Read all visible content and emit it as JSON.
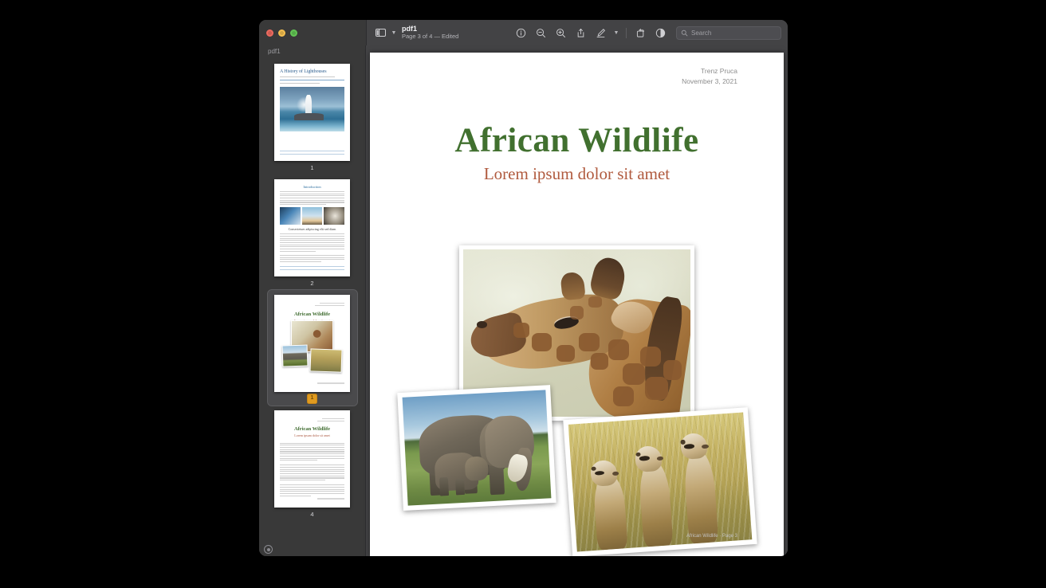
{
  "window": {
    "traffic_lights": [
      "close",
      "minimize",
      "zoom"
    ],
    "sidebar_label": "pdf1",
    "title": "pdf1",
    "subtitle": "Page 3 of 4 — Edited"
  },
  "toolbar": {
    "sidebar_toggle_icon": "sidebar-icon",
    "sidebar_chevron_icon": "chevron-down-icon",
    "tools": [
      {
        "name": "info-button",
        "icon": "info-circle-icon"
      },
      {
        "name": "zoom-out-button",
        "icon": "magnifier-minus-icon"
      },
      {
        "name": "zoom-in-button",
        "icon": "magnifier-plus-icon"
      },
      {
        "name": "share-button",
        "icon": "share-up-arrow-icon"
      },
      {
        "name": "markup-button",
        "icon": "pen-underline-icon"
      },
      {
        "name": "markup-options-button",
        "icon": "chevron-down-icon"
      },
      {
        "name": "rotate-button",
        "icon": "rotate-rectangle-icon"
      },
      {
        "name": "highlight-button",
        "icon": "contrast-circle-icon"
      }
    ],
    "search_placeholder": "Search",
    "search_value": "",
    "search_icon": "search-icon"
  },
  "sidebar": {
    "footer_icon": "settings-circle-icon",
    "thumbnails": [
      {
        "page": "1",
        "selected": false,
        "kind": "lighthouse",
        "title": "A History of Lighthouses",
        "subtitle": "Lorem ipsum dolor sit amet ligula",
        "meta": "Trenz Pruca · November 3, 2021",
        "footer": "A HISTORY OF LIGHTHOUSES — TRENZ PRUCA"
      },
      {
        "page": "2",
        "selected": false,
        "kind": "introduction",
        "title": "Introduction",
        "heading": "Consectetuer adipiscing elit sed diam",
        "footer": "A HISTORY OF LIGHTHOUSES — TRENZ PRUCA"
      },
      {
        "page": "3",
        "selected": true,
        "badge": "1",
        "kind": "wildlife-cover",
        "title": "African Wildlife",
        "subtitle": "Lorem ipsum dolor sit amet",
        "meta": "Trenz Pruca · November 3, 2021",
        "footer": "African Wildlife · Page 3"
      },
      {
        "page": "4",
        "selected": false,
        "kind": "wildlife-text",
        "title": "African Wildlife",
        "subtitle": "Lorem ipsum dolor sit amet",
        "meta": "Trenz Pruca · November 3, 2021",
        "footer": "African Wildlife · Page 4"
      }
    ]
  },
  "document": {
    "author": "Trenz Pruca",
    "date": "November 3, 2021",
    "title": "African Wildlife",
    "subtitle": "Lorem ipsum dolor sit amet",
    "title_color": "#41702f",
    "subtitle_color": "#b05a3e",
    "photos": [
      {
        "name": "giraffe-photo",
        "caption": "Giraffe head and neck in profile"
      },
      {
        "name": "elephant-photo",
        "caption": "Adult elephant with calf on savanna"
      },
      {
        "name": "meerkat-photo",
        "caption": "Three meerkats standing in tall grass"
      }
    ],
    "footer": "African Wildlife · Page 3"
  }
}
